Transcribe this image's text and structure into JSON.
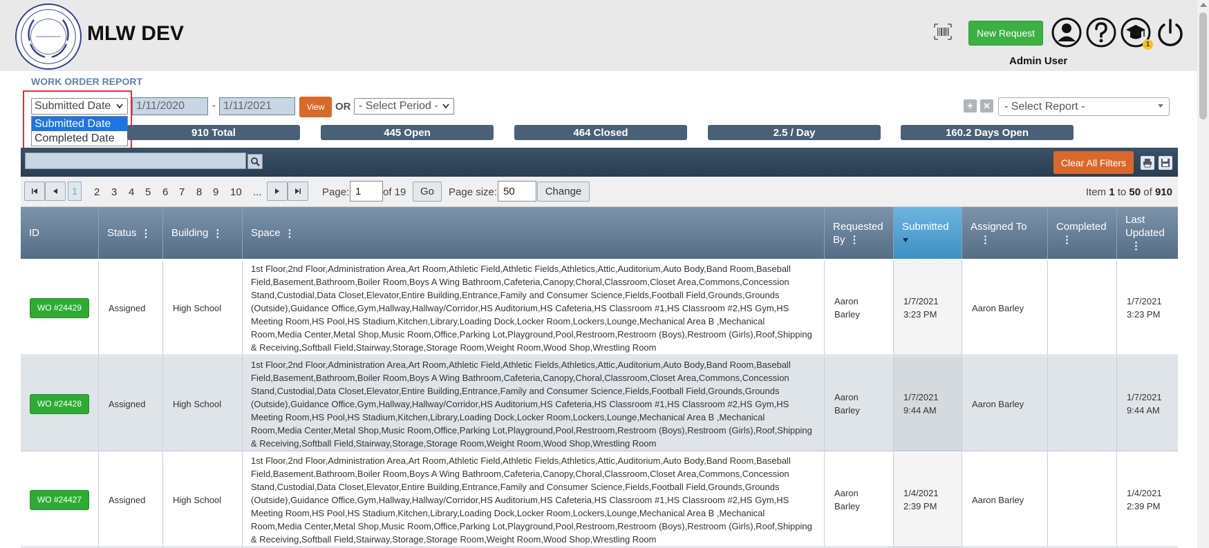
{
  "header": {
    "app_title": "MLW DEV",
    "new_request_label": "New Request",
    "user_name": "Admin User",
    "notification_count": "1",
    "icons": [
      "barcode-icon",
      "user-circle-icon",
      "help-icon",
      "graduation-cap-icon",
      "power-icon"
    ]
  },
  "report": {
    "title": "WORK ORDER REPORT",
    "date_type_selected": "Submitted Date",
    "date_type_options": [
      "Submitted Date",
      "Completed Date"
    ],
    "start_date": "1/11/2020",
    "end_date": "1/11/2021",
    "date_separator": "-",
    "view_label": "View",
    "or_label": "OR",
    "period_placeholder": "- Select Period -",
    "report_placeholder": "- Select Report -"
  },
  "stats": [
    "910 Total",
    "445 Open",
    "464 Closed",
    "2.5 / Day",
    "160.2 Days Open"
  ],
  "toolbar": {
    "clear_filters_label": "Clear All Filters"
  },
  "pager": {
    "pages": [
      "1",
      "2",
      "3",
      "4",
      "5",
      "6",
      "7",
      "8",
      "9",
      "10",
      "..."
    ],
    "page_label": "Page:",
    "page_value": "1",
    "of_label": "of 19",
    "go_label": "Go",
    "page_size_label": "Page size:",
    "page_size_value": "50",
    "change_label": "Change",
    "item_text_1": "Item",
    "item_from": "1",
    "item_to_label": "to",
    "item_to": "50",
    "item_of_label": "of",
    "item_total": "910"
  },
  "table": {
    "headers": {
      "id": "ID",
      "status": "Status",
      "building": "Building",
      "space": "Space",
      "requested_by_1": "Requested",
      "requested_by_2": "By",
      "submitted": "Submitted",
      "assigned_to": "Assigned To",
      "completed": "Completed",
      "last_updated_1": "Last",
      "last_updated_2": "Updated"
    },
    "rows": [
      {
        "id": "WO #24429",
        "status": "Assigned",
        "building": "High School",
        "space": "1st Floor,2nd Floor,Administration Area,Art Room,Athletic Field,Athletic Fields,Athletics,Attic,Auditorium,Auto Body,Band Room,Baseball Field,Basement,Bathroom,Boiler Room,Boys A Wing Bathroom,Cafeteria,Canopy,Choral,Classroom,Closet Area,Commons,Concession Stand,Custodial,Data Closet,Elevator,Entire Building,Entrance,Family and Consumer Science,Fields,Football Field,Grounds,Grounds (Outside),Guidance Office,Gym,Hallway,Hallway/Corridor,HS Auditorium,HS Cafeteria,HS Classroom #1,HS Classroom #2,HS Gym,HS Meeting Room,HS Pool,HS Stadium,Kitchen,Library,Loading Dock,Locker Room,Lockers,Lounge,Mechanical Area B ,Mechanical Room,Media Center,Metal Shop,Music Room,Office,Parking Lot,Playground,Pool,Restroom,Restroom (Boys),Restroom (Girls),Roof,Shipping & Receiving,Softball Field,Stairway,Storage,Storage Room,Weight Room,Wood Shop,Wrestling Room",
        "requested_first": "Aaron",
        "requested_last": "Barley",
        "submitted_date": "1/7/2021",
        "submitted_time": "3:23 PM",
        "assigned_to": "Aaron Barley",
        "completed": "",
        "updated_date": "1/7/2021",
        "updated_time": "3:23 PM"
      },
      {
        "id": "WO #24428",
        "status": "Assigned",
        "building": "High School",
        "space": "1st Floor,2nd Floor,Administration Area,Art Room,Athletic Field,Athletic Fields,Athletics,Attic,Auditorium,Auto Body,Band Room,Baseball Field,Basement,Bathroom,Boiler Room,Boys A Wing Bathroom,Cafeteria,Canopy,Choral,Classroom,Closet Area,Commons,Concession Stand,Custodial,Data Closet,Elevator,Entire Building,Entrance,Family and Consumer Science,Fields,Football Field,Grounds,Grounds (Outside),Guidance Office,Gym,Hallway,Hallway/Corridor,HS Auditorium,HS Cafeteria,HS Classroom #1,HS Classroom #2,HS Gym,HS Meeting Room,HS Pool,HS Stadium,Kitchen,Library,Loading Dock,Locker Room,Lockers,Lounge,Mechanical Area B ,Mechanical Room,Media Center,Metal Shop,Music Room,Office,Parking Lot,Playground,Pool,Restroom,Restroom (Boys),Restroom (Girls),Roof,Shipping & Receiving,Softball Field,Stairway,Storage,Storage Room,Weight Room,Wood Shop,Wrestling Room",
        "requested_first": "Aaron",
        "requested_last": "Barley",
        "submitted_date": "1/7/2021",
        "submitted_time": "9:44 AM",
        "assigned_to": "Aaron Barley",
        "completed": "",
        "updated_date": "1/7/2021",
        "updated_time": "9:44 AM"
      },
      {
        "id": "WO #24427",
        "status": "Assigned",
        "building": "High School",
        "space": "1st Floor,2nd Floor,Administration Area,Art Room,Athletic Field,Athletic Fields,Athletics,Attic,Auditorium,Auto Body,Band Room,Baseball Field,Basement,Bathroom,Boiler Room,Boys A Wing Bathroom,Cafeteria,Canopy,Choral,Classroom,Closet Area,Commons,Concession Stand,Custodial,Data Closet,Elevator,Entire Building,Entrance,Family and Consumer Science,Fields,Football Field,Grounds,Grounds (Outside),Guidance Office,Gym,Hallway,Hallway/Corridor,HS Auditorium,HS Cafeteria,HS Classroom #1,HS Classroom #2,HS Gym,HS Meeting Room,HS Pool,HS Stadium,Kitchen,Library,Loading Dock,Locker Room,Lockers,Lounge,Mechanical Area B ,Mechanical Room,Media Center,Metal Shop,Music Room,Office,Parking Lot,Playground,Pool,Restroom,Restroom (Boys),Restroom (Girls),Roof,Shipping & Receiving,Softball Field,Stairway,Storage,Storage Room,Weight Room,Wood Shop,Wrestling Room",
        "requested_first": "Aaron",
        "requested_last": "Barley",
        "submitted_date": "1/4/2021",
        "submitted_time": "2:39 PM",
        "assigned_to": "Aaron Barley",
        "completed": "",
        "updated_date": "1/4/2021",
        "updated_time": "2:39 PM"
      }
    ]
  },
  "colors": {
    "header_bg": "#e9e9e9",
    "accent_green": "#3cb043",
    "accent_orange": "#d9692a",
    "stat_bg": "#4a6077",
    "title_blue": "#5b84ab",
    "sorted_header": "#3d90c4"
  }
}
